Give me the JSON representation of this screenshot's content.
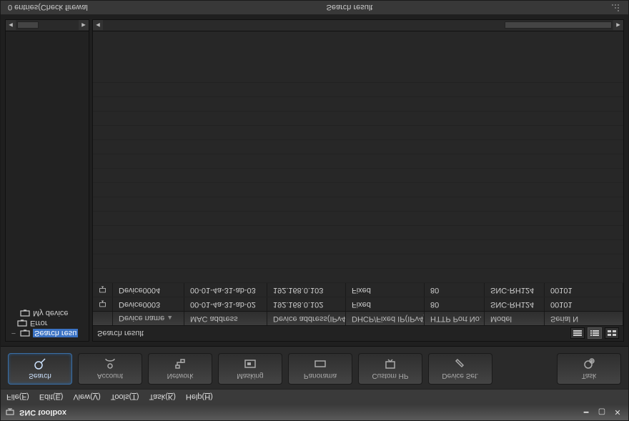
{
  "title": "SNC toolbox",
  "menu": [
    {
      "label": "File",
      "accel": "F"
    },
    {
      "label": "Edit",
      "accel": "E"
    },
    {
      "label": "View",
      "accel": "V"
    },
    {
      "label": "Tools",
      "accel": "T"
    },
    {
      "label": "Task",
      "accel": "K"
    },
    {
      "label": "Help",
      "accel": "H"
    }
  ],
  "toolbar": {
    "search": "Search",
    "account": "Account",
    "network": "Network",
    "masking": "Masking",
    "panorama": "Panorama",
    "customhp": "Custom HP",
    "deviceset": "Device Set.",
    "task": "Task"
  },
  "tree": {
    "searchresult": "Search resu",
    "error": "Error",
    "mydevice": "My device"
  },
  "main": {
    "title": "Search result",
    "columns": {
      "name": "Device name",
      "mac": "MAC address",
      "ip": "Device address(IPv4)",
      "dhcp": "DHCP/Fixed IP(IPv4)",
      "port": "HTTP Port No.",
      "model": "Model",
      "serial": "Serial N"
    },
    "rows": [
      {
        "name": "Device0003",
        "mac": "00-01-4a-31-ab-02",
        "ip": "192.168.0.102",
        "dhcp": "Fixed",
        "port": "80",
        "model": "SNC-RH124",
        "serial": "00101"
      },
      {
        "name": "Device0004",
        "mac": "00-01-4a-31-ab-03",
        "ip": "192.168.0.103",
        "dhcp": "Fixed",
        "port": "80",
        "model": "SNC-RH124",
        "serial": "00101"
      }
    ]
  },
  "status": {
    "entries": "0 entries(Check firewal",
    "center": "Search result"
  }
}
